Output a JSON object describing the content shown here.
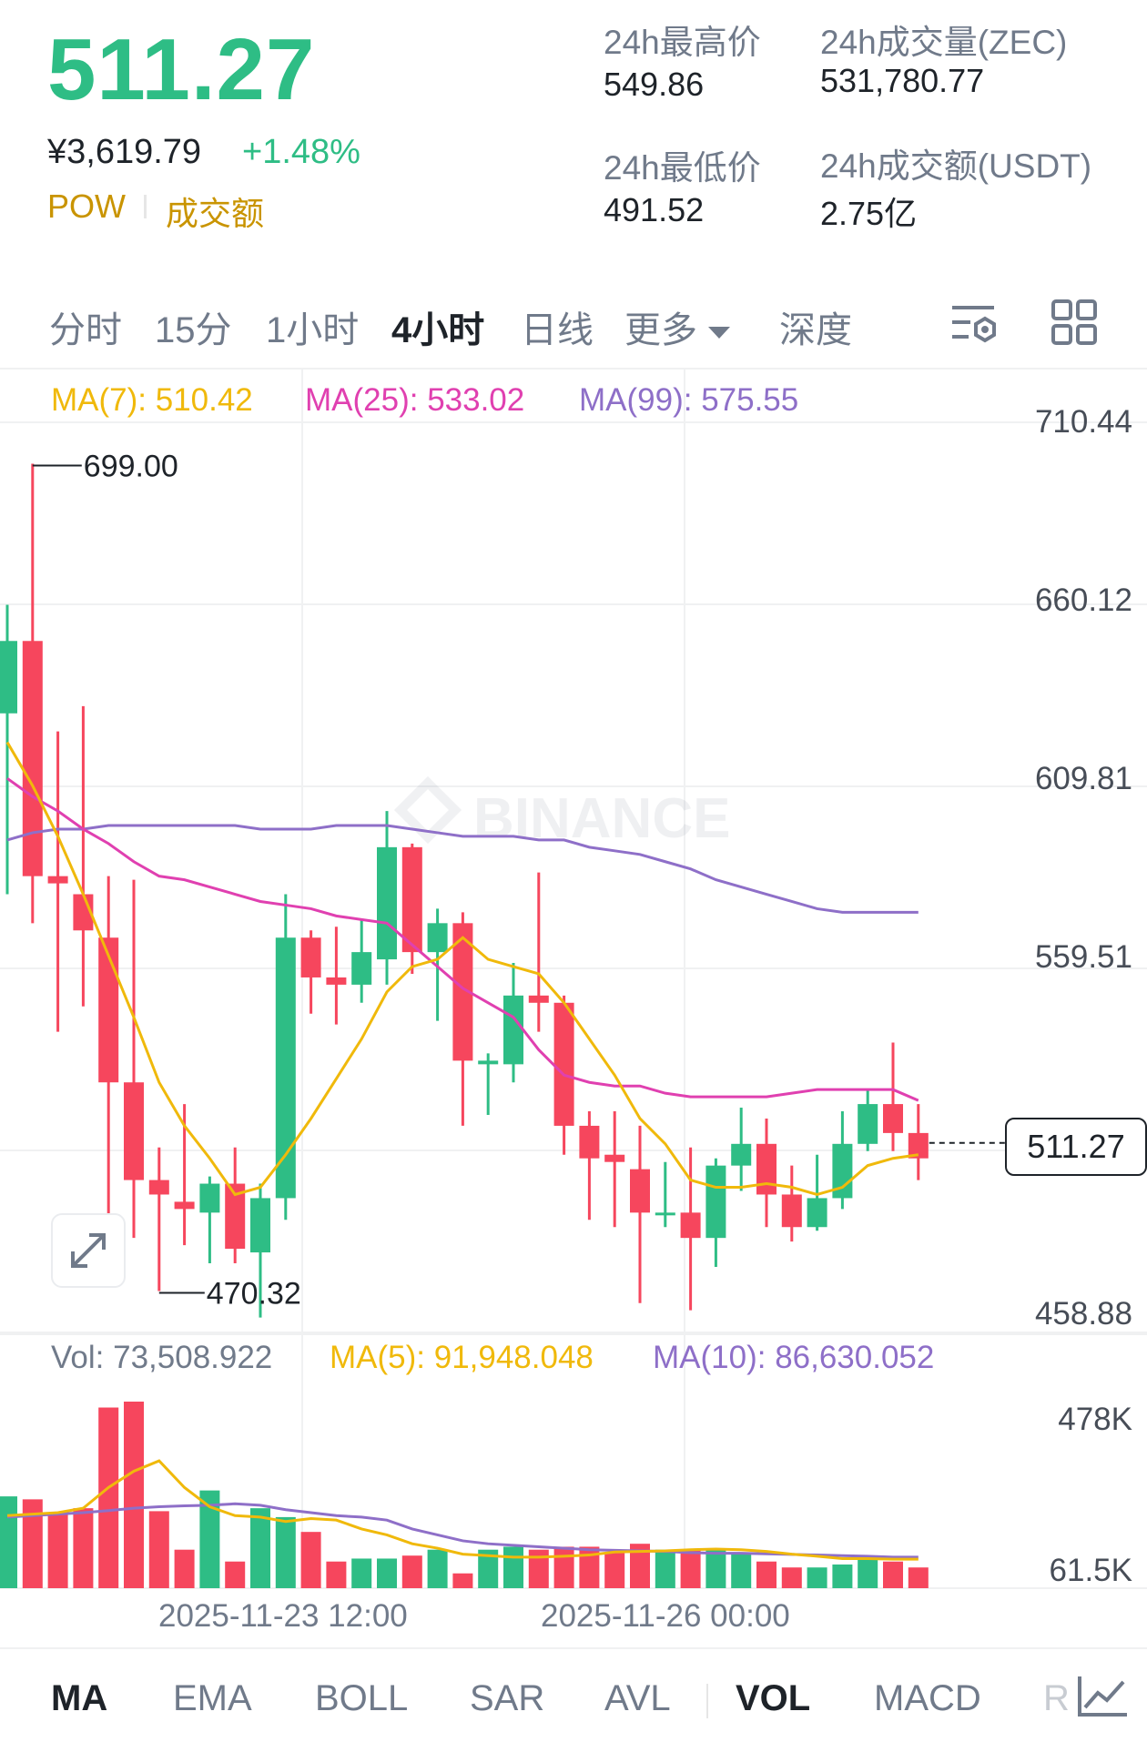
{
  "ticker": {
    "last_price": "511.27",
    "cny_price": "¥3,619.79",
    "change_pct": "+1.48%",
    "tag_1": "POW",
    "tag_2": "成交额"
  },
  "stats": {
    "high_label": "24h最高价",
    "high": "549.86",
    "low_label": "24h最低价",
    "low": "491.52",
    "vol_label": "24h成交量(ZEC)",
    "vol": "531,780.77",
    "amount_label": "24h成交额(USDT)",
    "amount": "2.75亿"
  },
  "tabs": {
    "t1": "分时",
    "t2": "15分",
    "t3": "1小时",
    "t4": "4小时",
    "t5": "日线",
    "t6": "更多",
    "t7": "深度"
  },
  "icons": {
    "settings": "chart-settings-icon",
    "layout": "grid-layout-icon",
    "expand": "expand-arrows-icon",
    "drawing": "drawing-tool-icon"
  },
  "ma_legend": {
    "ma7": "MA(7): 510.42",
    "ma25": "MA(25): 533.02",
    "ma99": "MA(99): 575.55"
  },
  "y_axis": [
    "710.44",
    "660.12",
    "609.81",
    "559.51",
    "458.88"
  ],
  "last_label": "511.27",
  "hi_marker": "699.00",
  "lo_marker": "470.32",
  "watermark": "BINANCE",
  "vol_legend": {
    "vol": "Vol: 73,508.922",
    "ma5": "MA(5): 91,948.048",
    "ma10": "MA(10): 86,630.052"
  },
  "vol_axis": {
    "top": "478K",
    "bottom": "61.5K"
  },
  "x_axis": {
    "t1": "2025-11-23 12:00",
    "t2": "2025-11-26 00:00"
  },
  "bottom_tabs": {
    "b1": "MA",
    "b2": "EMA",
    "b3": "BOLL",
    "b4": "SAR",
    "b5": "AVL",
    "b6": "VOL",
    "b7": "MACD",
    "b8": "R"
  },
  "colors": {
    "up": "#2ebd85",
    "down": "#f6465d",
    "ma7": "#f0b90b",
    "ma25": "#e040b0",
    "ma99": "#8e6fc8",
    "accent": "#c99400"
  },
  "chart_data": {
    "type": "candlestick",
    "interval": "4小时",
    "ylim": [
      458.88,
      710.44
    ],
    "high_marker": 699.0,
    "low_marker": 470.32,
    "last_price": 511.27,
    "candles": [
      {
        "o": 630,
        "h": 660,
        "c": 650,
        "l": 580
      },
      {
        "o": 650,
        "h": 699,
        "c": 585,
        "l": 572
      },
      {
        "o": 585,
        "h": 625,
        "c": 583,
        "l": 542
      },
      {
        "o": 580,
        "h": 632,
        "c": 570,
        "l": 549
      },
      {
        "o": 568,
        "h": 585,
        "c": 528,
        "l": 483
      },
      {
        "o": 528,
        "h": 584,
        "c": 501,
        "l": 485
      },
      {
        "o": 501,
        "h": 510,
        "c": 497,
        "l": 470.32
      },
      {
        "o": 495,
        "h": 522,
        "c": 493,
        "l": 483
      },
      {
        "o": 492,
        "h": 502,
        "c": 500,
        "l": 478
      },
      {
        "o": 500,
        "h": 510,
        "c": 482,
        "l": 478
      },
      {
        "o": 481,
        "h": 500,
        "c": 496,
        "l": 463
      },
      {
        "o": 496,
        "h": 580,
        "c": 568,
        "l": 490
      },
      {
        "o": 568,
        "h": 570,
        "c": 557,
        "l": 547
      },
      {
        "o": 557,
        "h": 571,
        "c": 555,
        "l": 544
      },
      {
        "o": 555,
        "h": 573,
        "c": 564,
        "l": 550
      },
      {
        "o": 562,
        "h": 603,
        "c": 593,
        "l": 555
      },
      {
        "o": 593,
        "h": 594,
        "c": 564,
        "l": 558
      },
      {
        "o": 564,
        "h": 576,
        "c": 572,
        "l": 545
      },
      {
        "o": 572,
        "h": 575,
        "c": 534,
        "l": 516
      },
      {
        "o": 533,
        "h": 536,
        "c": 534,
        "l": 519
      },
      {
        "o": 533,
        "h": 561,
        "c": 552,
        "l": 528
      },
      {
        "o": 552,
        "h": 586,
        "c": 550,
        "l": 542
      },
      {
        "o": 550,
        "h": 552,
        "c": 516,
        "l": 508
      },
      {
        "o": 516,
        "h": 520,
        "c": 507,
        "l": 490
      },
      {
        "o": 508,
        "h": 520,
        "c": 506,
        "l": 488
      },
      {
        "o": 504,
        "h": 516,
        "c": 492,
        "l": 467
      },
      {
        "o": 492,
        "h": 506,
        "c": 492,
        "l": 488
      },
      {
        "o": 492,
        "h": 510,
        "c": 485,
        "l": 465
      },
      {
        "o": 485,
        "h": 507,
        "c": 505,
        "l": 477
      },
      {
        "o": 505,
        "h": 521,
        "c": 511,
        "l": 498
      },
      {
        "o": 511,
        "h": 518,
        "c": 497,
        "l": 488
      },
      {
        "o": 497,
        "h": 505,
        "c": 488,
        "l": 484
      },
      {
        "o": 488,
        "h": 508,
        "c": 496,
        "l": 487
      },
      {
        "o": 496,
        "h": 520,
        "c": 511,
        "l": 493
      },
      {
        "o": 511,
        "h": 526,
        "c": 522,
        "l": 509
      },
      {
        "o": 522,
        "h": 539,
        "c": 514,
        "l": 509
      },
      {
        "o": 514,
        "h": 522,
        "c": 507,
        "l": 501
      }
    ],
    "ma7": [
      622,
      610,
      596,
      580,
      563,
      546,
      528,
      516,
      507,
      497,
      499,
      508,
      518,
      529,
      540,
      553,
      560,
      562,
      568,
      562,
      560,
      558,
      550,
      540,
      530,
      518,
      511,
      501,
      499,
      499,
      500,
      499,
      497,
      499,
      505,
      507,
      508
    ],
    "ma25": [
      612,
      607,
      603,
      598,
      594,
      589,
      585,
      584,
      582,
      580,
      578,
      577,
      576,
      574,
      573,
      572,
      566,
      560,
      554,
      550,
      546,
      537,
      530,
      528,
      527,
      527,
      525,
      524,
      524,
      524,
      524,
      525,
      526,
      526,
      526,
      526,
      523
    ],
    "ma99": [
      595,
      597,
      598,
      598,
      599,
      599,
      599,
      599,
      599,
      599,
      598,
      598,
      598,
      599,
      599,
      599,
      598,
      597,
      596,
      596,
      596,
      595,
      595,
      593,
      592,
      591,
      589,
      587,
      584,
      582,
      580,
      578,
      576,
      575,
      575,
      575,
      575
    ],
    "volume": {
      "ylim": [
        61500,
        478000
      ],
      "bars": [
        310,
        300,
        250,
        270,
        610,
        630,
        260,
        130,
        330,
        90,
        270,
        240,
        190,
        90,
        100,
        100,
        110,
        130,
        50,
        130,
        140,
        130,
        140,
        140,
        120,
        150,
        130,
        130,
        130,
        120,
        90,
        70,
        70,
        80,
        100,
        90,
        70
      ],
      "ma5": [
        245,
        250,
        255,
        270,
        340,
        395,
        430,
        340,
        275,
        245,
        240,
        225,
        235,
        230,
        200,
        180,
        150,
        135,
        115,
        110,
        105,
        105,
        108,
        112,
        122,
        124,
        126,
        130,
        132,
        130,
        124,
        115,
        108,
        100,
        100,
        98,
        98
      ],
      "ma10": [
        240,
        245,
        250,
        255,
        262,
        270,
        275,
        278,
        280,
        285,
        280,
        265,
        255,
        245,
        240,
        230,
        200,
        180,
        160,
        150,
        145,
        140,
        135,
        130,
        128,
        126,
        124,
        120,
        118,
        118,
        116,
        114,
        112,
        110,
        108,
        105,
        105
      ]
    },
    "x_ticks": [
      "2025-11-23 12:00",
      "2025-11-26 00:00"
    ]
  }
}
